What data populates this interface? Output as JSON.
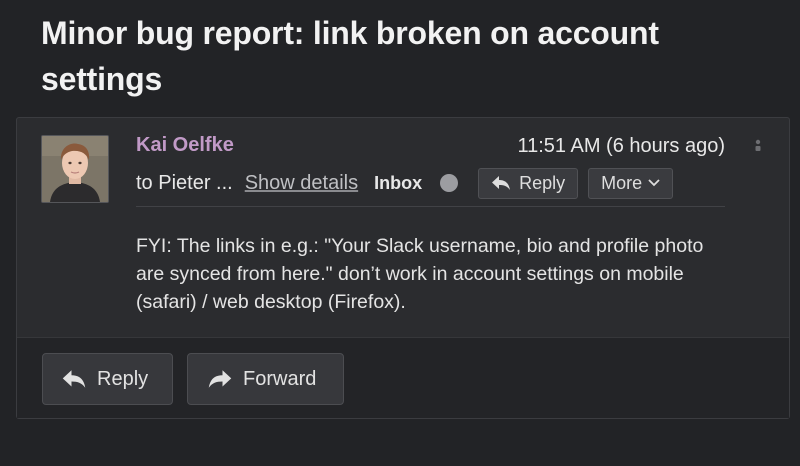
{
  "message": {
    "subject": "Minor bug report: link broken on account settings",
    "sender_name": "Kai Oelfke",
    "timestamp": "11:51 AM (6 hours ago)",
    "recipients": "to Pieter ...",
    "show_details_label": "Show details",
    "folder": "Inbox",
    "body": "FYI: The links in e.g.: \"Your Slack username, bio and profile photo are synced from here.\" don’t work in account settings on mobile (safari) / web desktop (Firefox)."
  },
  "header_actions": {
    "reply_label": "Reply",
    "more_label": "More"
  },
  "footer_actions": {
    "reply_label": "Reply",
    "forward_label": "Forward"
  },
  "icons": {
    "reply": "reply-arrow-icon",
    "forward": "forward-arrow-icon",
    "more": "chevron-down-icon",
    "status": "unread-dot-icon",
    "drag": "drag-handle-icon"
  },
  "colors": {
    "background": "#222326",
    "card": "#2b2c2f",
    "sender": "#c19ac7",
    "text": "#e8e8e8"
  }
}
